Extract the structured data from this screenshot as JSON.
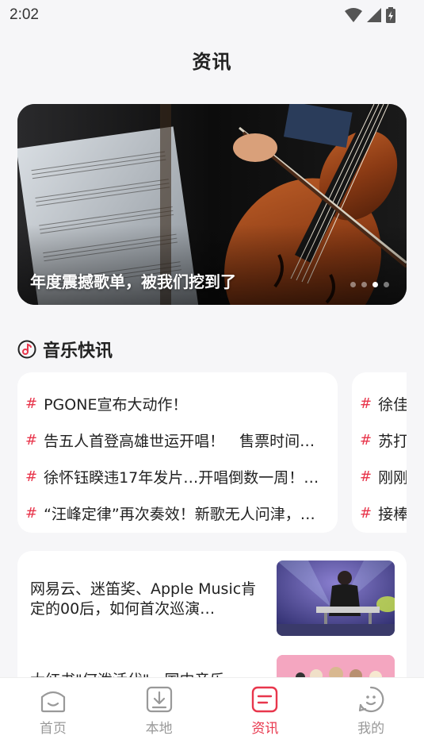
{
  "status_bar": {
    "time": "2:02"
  },
  "page_title": "资讯",
  "banner": {
    "caption": "年度震撼歌单，被我们挖到了",
    "dots": 4,
    "active_dot": 2
  },
  "section": {
    "title": "音乐快讯",
    "icon": "music-note-icon"
  },
  "news_cards": [
    {
      "items": [
        "PGONE宣布大动作！",
        "告五人首登高雄世运开唱！　售票时间…",
        "徐怀钰睽违17年发片…开唱倒数一周！…",
        "“汪峰定律”再次奏效！新歌无人问津，…"
      ]
    },
    {
      "items": [
        "徐佳",
        "苏打",
        "刚刚",
        "接棒"
      ]
    }
  ],
  "articles": [
    {
      "title": "网易云、迷笛奖、Apple Music肯定的00后，如何首次巡演…"
    },
    {
      "title": "大红书\"何泼活代\"，国内音乐…"
    }
  ],
  "bottom_nav": [
    {
      "label": "首页",
      "icon": "home-icon",
      "active": false
    },
    {
      "label": "本地",
      "icon": "download-icon",
      "active": false
    },
    {
      "label": "资讯",
      "icon": "news-icon",
      "active": true
    },
    {
      "label": "我的",
      "icon": "profile-icon",
      "active": false
    }
  ],
  "colors": {
    "accent": "#e8364c",
    "inactive": "#999999",
    "background": "#f6f6f8"
  }
}
